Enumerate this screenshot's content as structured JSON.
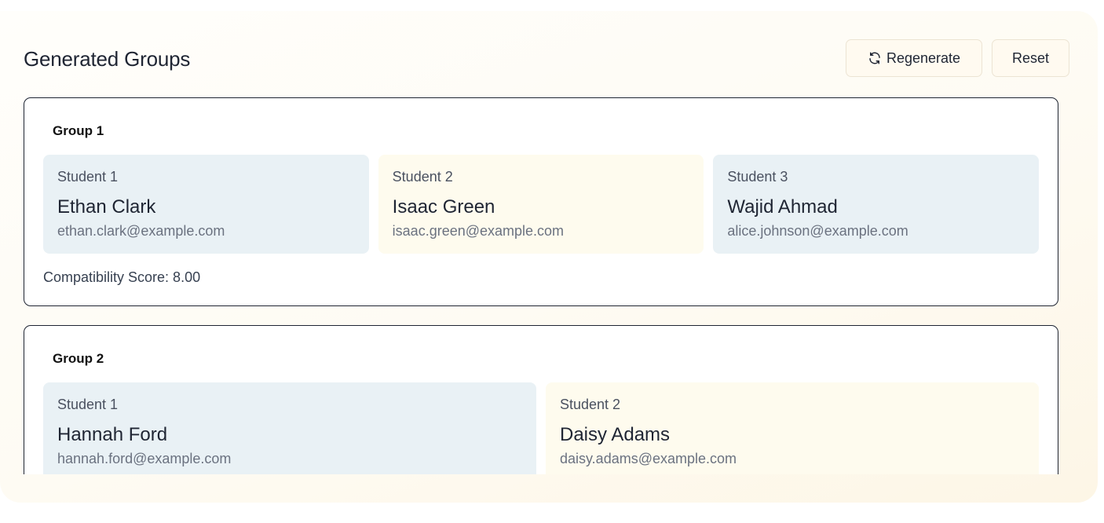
{
  "header": {
    "title": "Generated Groups",
    "regenerate_label": "Regenerate",
    "reset_label": "Reset"
  },
  "groups": [
    {
      "title": "Group 1",
      "students": [
        {
          "label": "Student 1",
          "name": "Ethan Clark",
          "email": "ethan.clark@example.com"
        },
        {
          "label": "Student 2",
          "name": "Isaac Green",
          "email": "isaac.green@example.com"
        },
        {
          "label": "Student 3",
          "name": "Wajid Ahmad",
          "email": "alice.johnson@example.com"
        }
      ],
      "score": "Compatibility Score: 8.00"
    },
    {
      "title": "Group 2",
      "students": [
        {
          "label": "Student 1",
          "name": "Hannah Ford",
          "email": "hannah.ford@example.com"
        },
        {
          "label": "Student 2",
          "name": "Daisy Adams",
          "email": "daisy.adams@example.com"
        }
      ]
    }
  ],
  "colors": {
    "student_odd_bg": "#e9f1f5",
    "student_even_bg": "#fefbee",
    "button_bg": "#fffaf0",
    "card_border": "#1f2533"
  },
  "icons": {
    "regenerate": "refresh-icon"
  }
}
